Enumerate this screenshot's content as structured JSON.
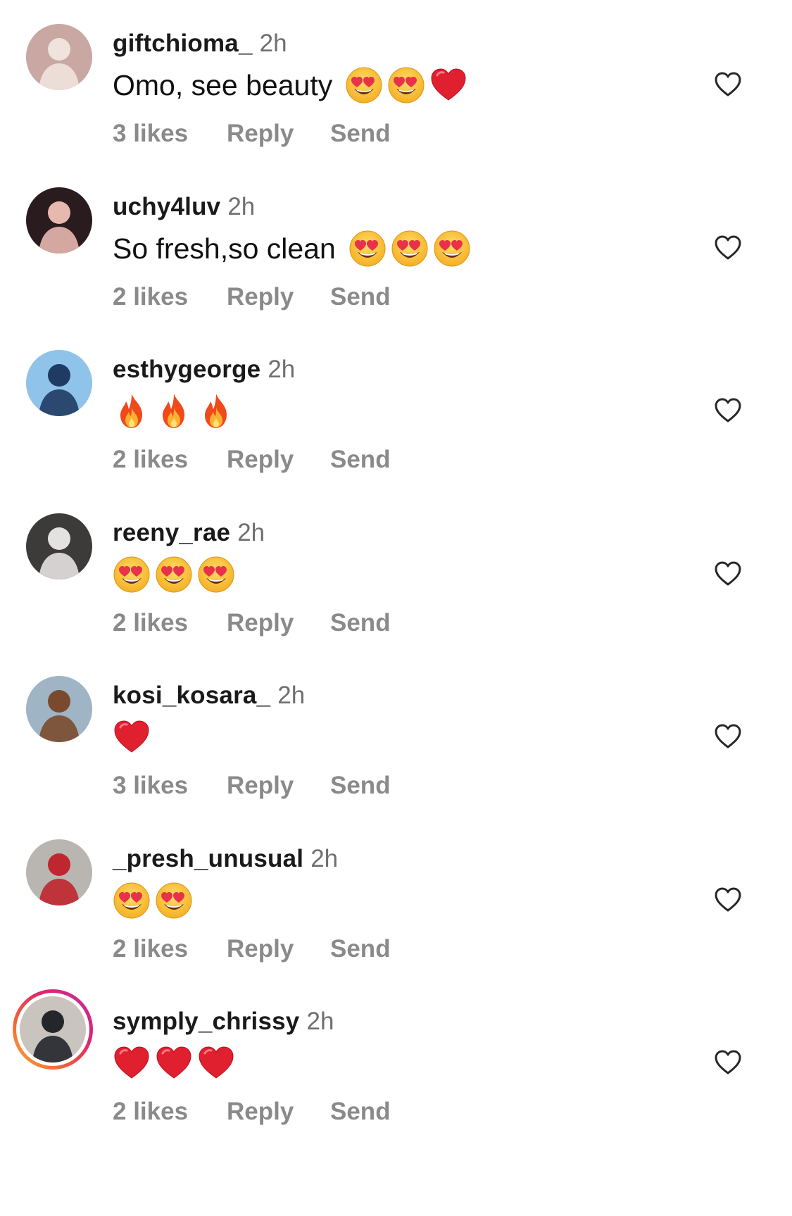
{
  "comments": [
    {
      "username": "giftchioma_",
      "time": "2h",
      "text": "Omo, see beauty",
      "emojis": [
        "heart-eyes-emoji",
        "heart-eyes-emoji",
        "red-heart-emoji"
      ],
      "likes": "3 likes",
      "reply": "Reply",
      "send": "Send",
      "avatar": {
        "bg": "#c9a7a3",
        "fg": "#efe3dd",
        "story": false
      }
    },
    {
      "username": "uchy4luv",
      "time": "2h",
      "text": "So fresh,so clean",
      "emojis": [
        "heart-eyes-emoji",
        "heart-eyes-emoji",
        "heart-eyes-emoji"
      ],
      "likes": "2 likes",
      "reply": "Reply",
      "send": "Send",
      "avatar": {
        "bg": "#2a1c1e",
        "fg": "#e7b8ae",
        "story": false
      }
    },
    {
      "username": "esthygeorge",
      "time": "2h",
      "text": "",
      "emojis": [
        "fire-emoji",
        "fire-emoji",
        "fire-emoji"
      ],
      "likes": "2 likes",
      "reply": "Reply",
      "send": "Send",
      "avatar": {
        "bg": "#8fc3ea",
        "fg": "#1f3b63",
        "story": false
      }
    },
    {
      "username": "reeny_rae",
      "time": "2h",
      "text": "",
      "emojis": [
        "heart-eyes-emoji",
        "heart-eyes-emoji",
        "heart-eyes-emoji"
      ],
      "likes": "2 likes",
      "reply": "Reply",
      "send": "Send",
      "avatar": {
        "bg": "#3d3a3a",
        "fg": "#e4e2e1",
        "story": false
      }
    },
    {
      "username": "kosi_kosara_",
      "time": "2h",
      "text": "",
      "emojis": [
        "red-heart-emoji"
      ],
      "likes": "3 likes",
      "reply": "Reply",
      "send": "Send",
      "avatar": {
        "bg": "#9fb4c4",
        "fg": "#7a4a2f",
        "story": false
      }
    },
    {
      "username": "_presh_unusual",
      "time": "2h",
      "text": "",
      "emojis": [
        "heart-eyes-emoji",
        "heart-eyes-emoji"
      ],
      "likes": "2 likes",
      "reply": "Reply",
      "send": "Send",
      "avatar": {
        "bg": "#b9b6b1",
        "fg": "#c0262f",
        "story": false
      }
    },
    {
      "username": "symply_chrissy",
      "time": "2h",
      "text": "",
      "emojis": [
        "red-heart-emoji",
        "red-heart-emoji",
        "red-heart-emoji"
      ],
      "likes": "2 likes",
      "reply": "Reply",
      "send": "Send",
      "avatar": {
        "bg": "#c9c4bd",
        "fg": "#23262b",
        "story": true
      }
    }
  ],
  "colors": {
    "username": "#1a1a1a",
    "meta": "#8a8a8a",
    "time": "#6f6f6f",
    "like_icon": "#262626"
  }
}
